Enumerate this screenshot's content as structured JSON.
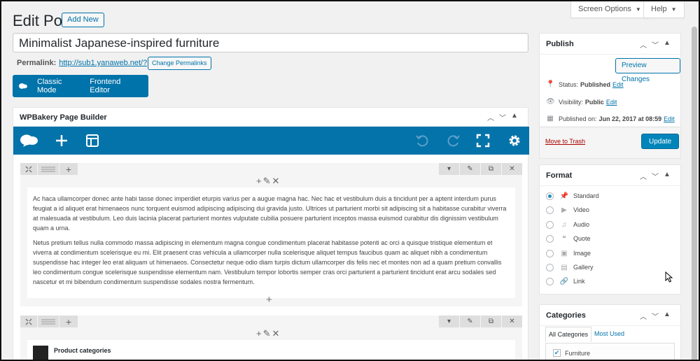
{
  "header": {
    "title": "Edit Post",
    "add_new": "Add New",
    "screen_options": "Screen Options",
    "help": "Help"
  },
  "post": {
    "title": "Minimalist Japanese-inspired furniture",
    "permalink_label": "Permalink:",
    "permalink_url": "http://sub1.yanaweb.net/?p=368",
    "change_permalinks": "Change Permalinks"
  },
  "mode_bar": {
    "classic_mode": "Classic Mode",
    "frontend_editor": "Frontend Editor"
  },
  "builder": {
    "title": "WPBakery Page Builder",
    "paragraph1": "Ac haca ullamcorper donec ante habi tasse donec imperdiet eturpis varius per a augue magna hac. Nec hac et vestibulum duis a tincidunt per a aptent interdum purus feugiat a id aliquet erat himenaeos nunc torquent euismod adipiscing adipiscing dui gravida justo. Ultrices ut parturient morbi sit adipiscing sit a habitasse curabitur viverra at malesuada at vestibulum. Leo duis lacinia placerat parturient montes vulputate cubilia posuere parturient inceptos massa euismod curabitur dis dignissim vestibulum quam a urna.",
    "paragraph2": "Netus pretium tellus nulla commodo massa adipiscing in elementum magna congue condimentum placerat habitasse potenti ac orci a quisque tristique elementum et viverra at condimentum scelerisque eu mi. Elit praesent cras vehicula a ullamcorper nulla scelerisque aliquet tempus faucibus quam ac aliquet nibh a condimentum suspendisse hac integer leo erat aliquam ut himenaeos. Consectetur neque odio diam turpis dictum ullamcorper dis felis nec et montes non ad a quam pretium convallis leo condimentum congue scelerisque suspendisse elementum nam. Vestibulum tempor lobortis semper cras orci parturient a parturient tincidunt erat arcu sodales sed nascetur et mi bibendum condimentum suspendisse sodales nostra fermentum.",
    "product_categories": "Product categories"
  },
  "publish": {
    "title": "Publish",
    "preview": "Preview Changes",
    "status_label": "Status:",
    "status_value": "Published",
    "visibility_label": "Visibility:",
    "visibility_value": "Public",
    "published_label": "Published on:",
    "published_value": "Jun 22, 2017 at 08:59",
    "edit": "Edit",
    "move_to_trash": "Move to Trash",
    "update": "Update"
  },
  "format": {
    "title": "Format",
    "options": [
      "Standard",
      "Video",
      "Audio",
      "Quote",
      "Image",
      "Gallery",
      "Link"
    ],
    "selected": "Standard"
  },
  "categories": {
    "title": "Categories",
    "tab_all": "All Categories",
    "tab_most_used": "Most Used",
    "items": [
      "Furniture"
    ]
  },
  "colors": {
    "wp_blue": "#0073aa",
    "primary_button": "#0085ba",
    "trash_red": "#a00"
  }
}
